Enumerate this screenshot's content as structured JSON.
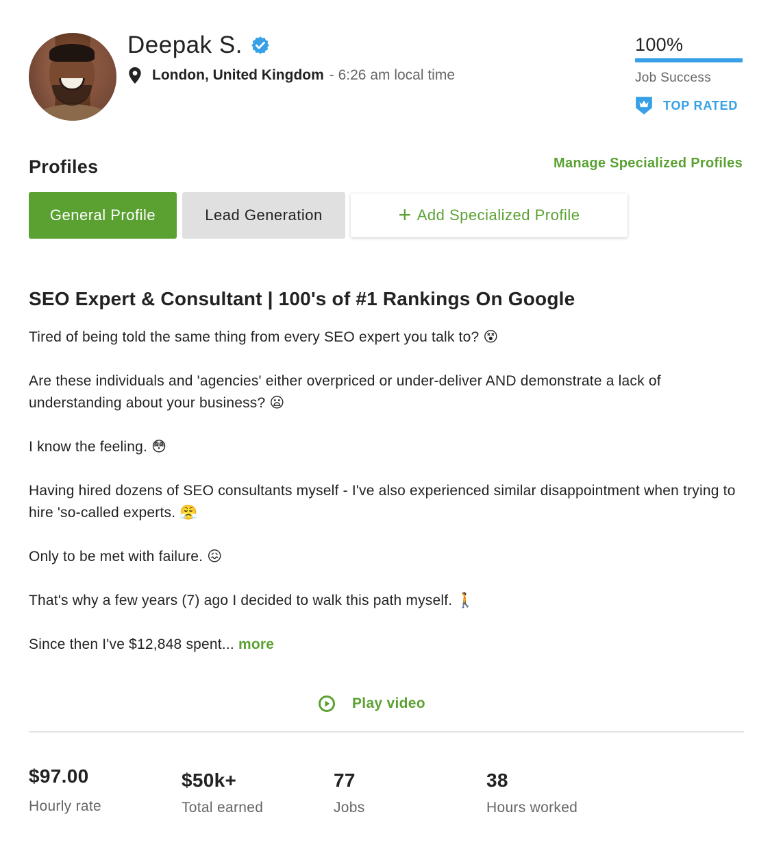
{
  "header": {
    "name": "Deepak S.",
    "location_city": "London, United Kingdom",
    "location_time": "- 6:26 am local time"
  },
  "job_success": {
    "percent_label": "100%",
    "percent_value": 100,
    "label": "Job Success"
  },
  "badge": {
    "label": "TOP RATED",
    "icon": "crown-shield-icon",
    "color": "#37a0e6"
  },
  "profiles": {
    "title": "Profiles",
    "manage_link": "Manage Specialized Profiles",
    "tabs": [
      {
        "label": "General Profile",
        "active": true
      },
      {
        "label": "Lead Generation",
        "active": false
      }
    ],
    "add_button": "Add Specialized Profile"
  },
  "overview": {
    "headline": "SEO Expert & Consultant | 100's of #1 Rankings On Google",
    "paragraphs": [
      "Tired of being told the same thing from every SEO expert you talk to? 😵",
      "Are these individuals and 'agencies' either overpriced or under-deliver AND demonstrate a lack of understanding about your business? 😦",
      "I know the feeling. 😳",
      "Having hired dozens of SEO consultants myself - I've also experienced similar disappointment when trying to hire 'so-called experts. 😤",
      "Only to be met with failure. 😖",
      "That's why a few years (7) ago I decided to walk this path myself. 🚶"
    ],
    "truncated": "Since then I've $12,848 spent...",
    "more_link": "more"
  },
  "video": {
    "label": "Play video"
  },
  "stats": [
    {
      "value": "$97.00",
      "label": "Hourly rate"
    },
    {
      "value": "$50k+",
      "label": "Total earned"
    },
    {
      "value": "77",
      "label": "Jobs"
    },
    {
      "value": "38",
      "label": "Hours worked"
    }
  ],
  "colors": {
    "brand_green": "#5aa132",
    "accent_blue": "#37a0e6",
    "text_dark": "#222222",
    "text_muted": "#656565"
  }
}
